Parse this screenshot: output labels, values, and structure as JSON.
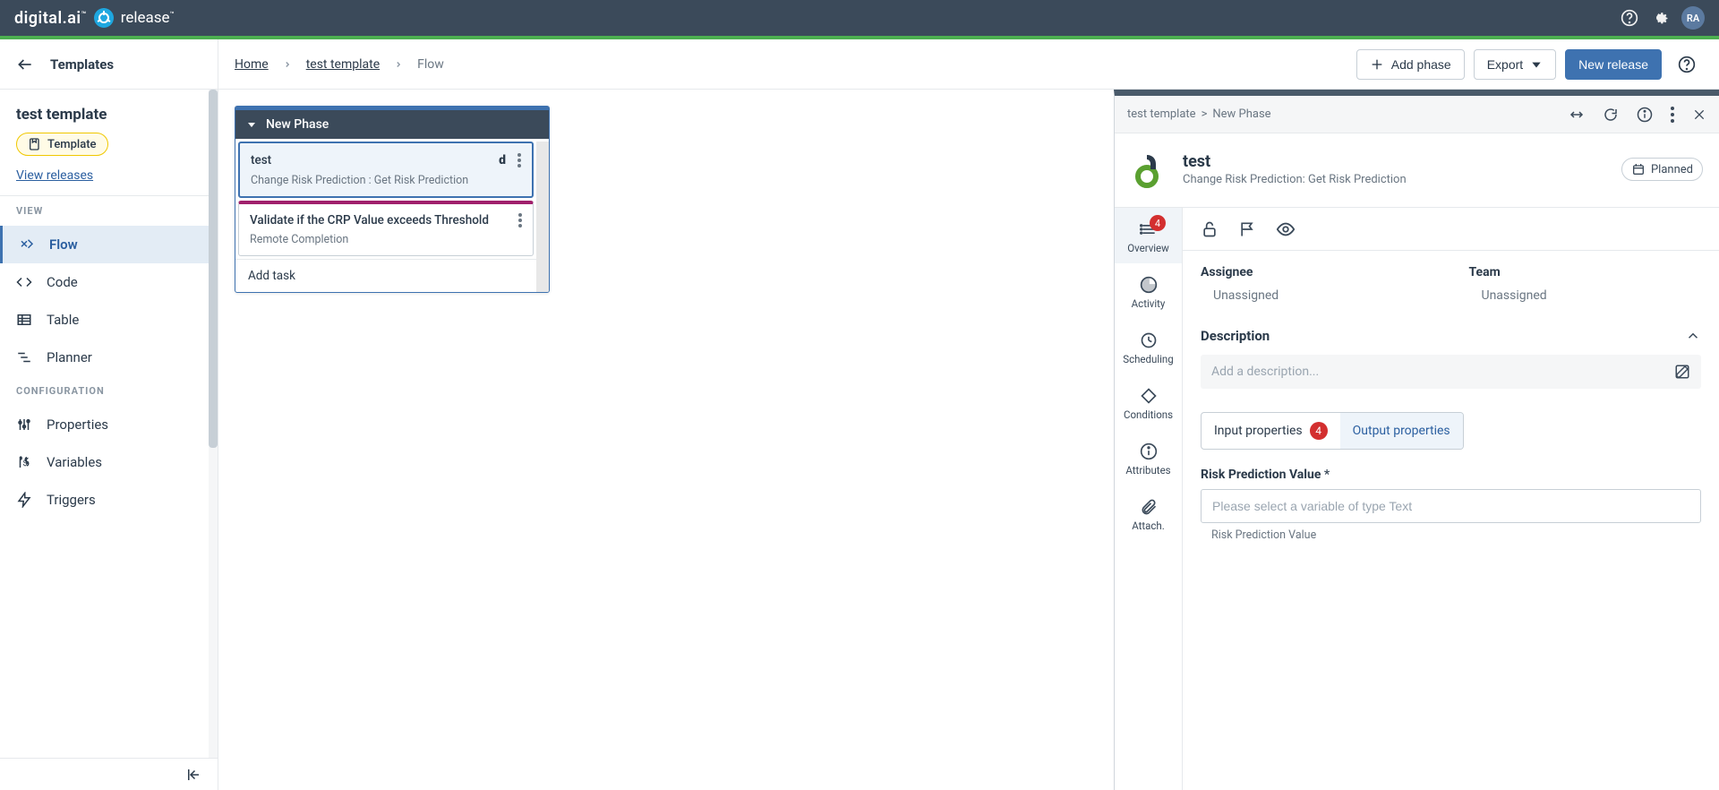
{
  "topbar": {
    "brand": "digital.ai",
    "product": "release",
    "avatar": "RA"
  },
  "header": {
    "back_title": "Templates",
    "breadcrumb": {
      "home": "Home",
      "tmpl": "test template",
      "current": "Flow"
    },
    "add_phase": "Add phase",
    "export": "Export",
    "new_release": "New release"
  },
  "sidebar": {
    "template_name": "test template",
    "template_badge": "Template",
    "view_releases": "View releases",
    "section_view": "VIEW",
    "flow": "Flow",
    "code": "Code",
    "table": "Table",
    "planner": "Planner",
    "section_config": "CONFIGURATION",
    "properties": "Properties",
    "variables": "Variables",
    "triggers": "Triggers"
  },
  "phase": {
    "name": "New Phase",
    "task1_title": "test",
    "task1_type": "Change Risk Prediction : Get Risk Prediction",
    "task2_title": "Validate if the CRP Value exceeds Threshold",
    "task2_type": "Remote Completion",
    "add_task": "Add task"
  },
  "detail": {
    "crumb_tmpl": "test template",
    "crumb_phase": "New Phase",
    "title": "test",
    "subtitle": "Change Risk Prediction: Get Risk Prediction",
    "status": "Planned",
    "tabs": {
      "overview": "Overview",
      "overview_badge": "4",
      "activity": "Activity",
      "scheduling": "Scheduling",
      "conditions": "Conditions",
      "attributes": "Attributes",
      "attach": "Attach."
    },
    "assignee_label": "Assignee",
    "assignee_value": "Unassigned",
    "team_label": "Team",
    "team_value": "Unassigned",
    "description_label": "Description",
    "description_placeholder": "Add a description...",
    "input_props": "Input properties",
    "input_count": "4",
    "output_props": "Output properties",
    "field_label": "Risk Prediction Value",
    "field_placeholder": "Please select a variable of type Text",
    "field_hint": "Risk Prediction Value"
  }
}
